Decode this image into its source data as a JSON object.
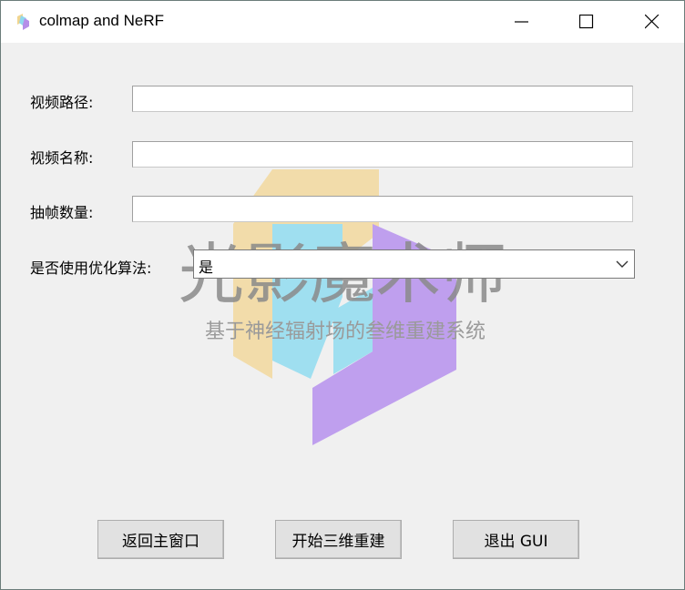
{
  "window": {
    "title": "colmap and NeRF"
  },
  "form": {
    "video_path_label": "视频路径:",
    "video_path_value": "",
    "video_name_label": "视频名称:",
    "video_name_value": "",
    "frame_count_label": "抽帧数量:",
    "frame_count_value": "",
    "optimize_label": "是否使用优化算法:",
    "optimize_value": "是"
  },
  "watermark": {
    "title": "光影魔术师",
    "subtitle": "基于神经辐射场的叁维重建系统"
  },
  "buttons": {
    "back": "返回主窗口",
    "start": "开始三维重建",
    "exit": "退出 GUI"
  }
}
